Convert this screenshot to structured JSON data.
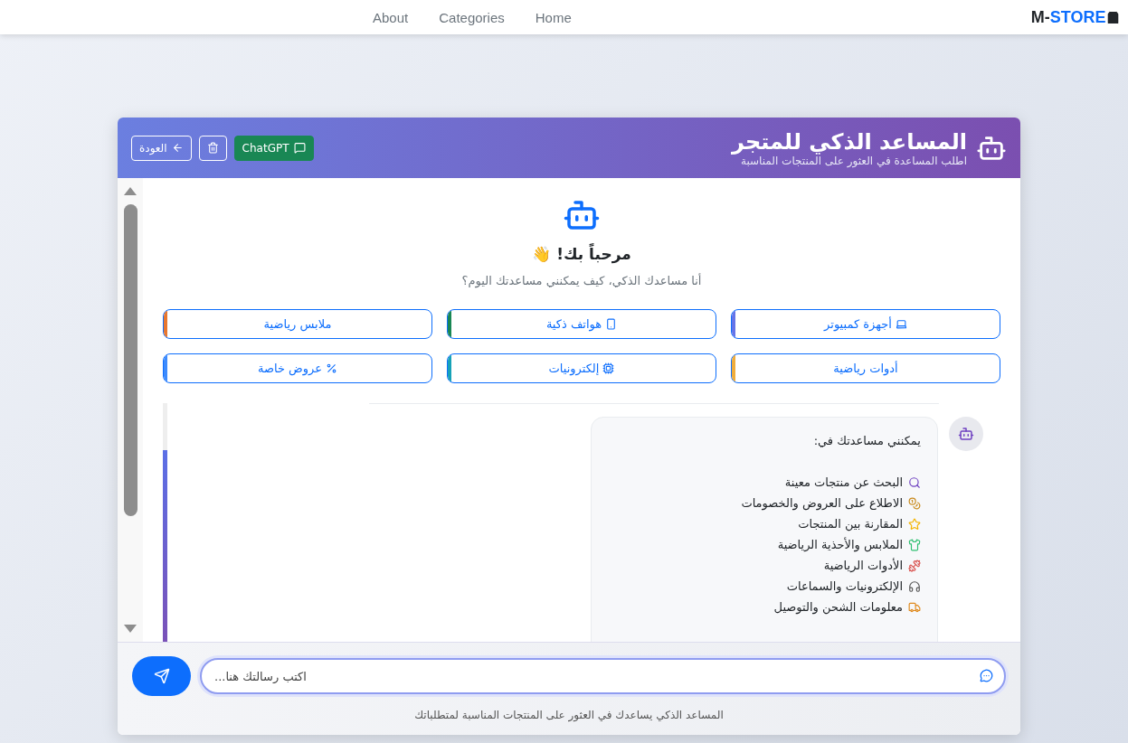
{
  "navbar": {
    "links": [
      "Home",
      "Categories",
      "About"
    ],
    "brand": {
      "first": "M-",
      "second": "STORE"
    }
  },
  "chat": {
    "header": {
      "title": "المساعد الذكي للمتجر",
      "subtitle": "اطلب المساعدة في العثور على المنتجات المناسبة",
      "buttons": [
        {
          "kind": "chatgpt",
          "label": "ChatGPT"
        },
        {
          "kind": "clear"
        },
        {
          "kind": "back",
          "label": "العودة"
        }
      ]
    },
    "welcome": {
      "title": "مرحباً بك!",
      "emoji": "👋",
      "subtitle": "أنا مساعدك الذكي، كيف يمكنني مساعدتك اليوم؟"
    },
    "suggestions": [
      {
        "label": "أجهزة كمبيوتر",
        "kind": "laptop",
        "color": "#6574e8"
      },
      {
        "label": "هواتف ذكية",
        "kind": "phone",
        "color": "#198754"
      },
      {
        "label": "ملابس رياضية",
        "kind": "plain",
        "color": "#e8772e"
      },
      {
        "label": "أدوات رياضية",
        "kind": "plain",
        "color": "#f0ad3c"
      },
      {
        "label": "إلكترونيات",
        "kind": "chip",
        "color": "#17a2b8"
      },
      {
        "label": "عروض خاصة",
        "kind": "percent",
        "color": "#3d8bfd"
      }
    ],
    "message": {
      "intro": "يمكنني مساعدتك في:",
      "items": [
        {
          "kind": "search",
          "text": "البحث عن منتجات معينة"
        },
        {
          "kind": "money",
          "text": "الاطلاع على العروض والخصومات"
        },
        {
          "kind": "star",
          "text": "المقارنة بين المنتجات"
        },
        {
          "kind": "shirt",
          "text": "الملابس والأحذية الرياضية"
        },
        {
          "kind": "dumbbell",
          "text": "الأدوات الرياضية"
        },
        {
          "kind": "headphones",
          "text": "الإلكترونيات والسماعات"
        },
        {
          "kind": "truck",
          "text": "معلومات الشحن والتوصيل"
        }
      ]
    },
    "input": {
      "placeholder": "...اكتب رسالتك هنا"
    },
    "footer_note": "المساعد الذكي يساعدك في العثور على المنتجات المناسبة لمتطلباتك"
  }
}
